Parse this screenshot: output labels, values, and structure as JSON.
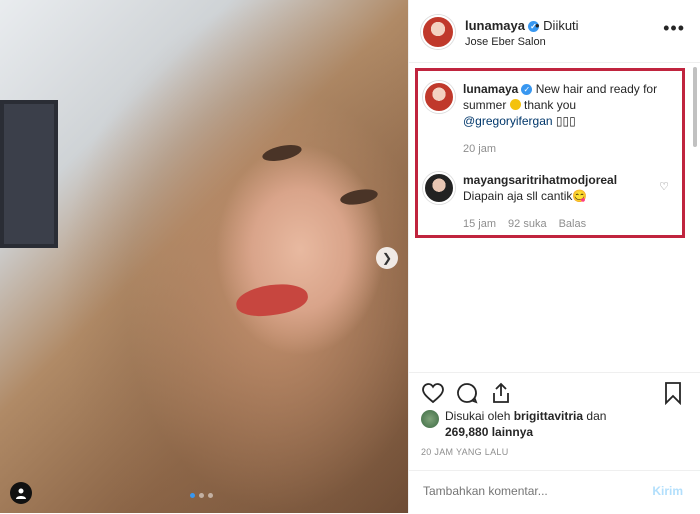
{
  "post": {
    "username": "lunamaya",
    "follow_status": "• Diikuti",
    "location": "Jose Eber Salon",
    "more": "•••"
  },
  "comments": [
    {
      "username": "lunamaya",
      "text_a": "New hair and ready for summer",
      "text_b": "thank you",
      "mention": "@gregoryifergan",
      "trail": "▯▯▯",
      "time": "20 jam"
    },
    {
      "username": "mayangsaritrihatmodjoreal",
      "text": "Diapain aja sll cantik😋",
      "time": "15 jam",
      "likes": "92 suka",
      "reply": "Balas"
    }
  ],
  "likes": {
    "prefix": "Disukai oleh",
    "user": "brigittavitria",
    "suffix": "dan",
    "count": "269,880 lainnya"
  },
  "time_ago": "20 JAM YANG LALU",
  "add_comment": {
    "placeholder": "Tambahkan komentar...",
    "send": "Kirim"
  },
  "icons": [
    "heart-icon",
    "comment-icon",
    "share-icon",
    "bookmark-icon",
    "verified-icon",
    "chevron-right-icon",
    "user-tag-icon",
    "more-icon"
  ]
}
